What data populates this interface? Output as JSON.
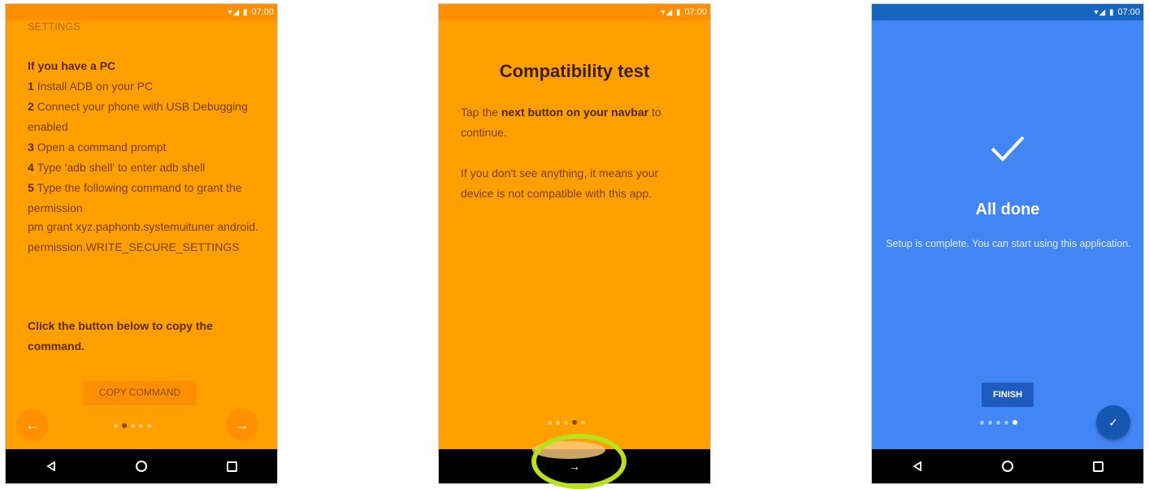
{
  "statusbar": {
    "icons": "▾◢ ▮",
    "time": "07:00"
  },
  "nav_icons": {
    "back": "back-icon",
    "home": "home-icon",
    "recent": "recent-apps-icon"
  },
  "screen1": {
    "faded_heading": "SETTINGS",
    "heading": "If you have a PC",
    "steps": [
      {
        "num": "1",
        "text": "Install ADB on your PC"
      },
      {
        "num": "2",
        "text": "Connect your phone with USB Debugging enabled"
      },
      {
        "num": "3",
        "text": "Open a command prompt"
      },
      {
        "num": "4",
        "text": "Type 'adb shell' to enter adb shell"
      },
      {
        "num": "5",
        "text": "Type the following command to grant the permission"
      }
    ],
    "command": "pm grant xyz.paphonb.systemuituner android.permission.WRITE_SECURE_SETTINGS",
    "instruction": "Click the button below to copy the command.",
    "copy_button": "COPY COMMAND",
    "prev_glyph": "←",
    "next_glyph": "→",
    "page_count": 5,
    "active_page": 1
  },
  "screen2": {
    "title": "Compatibility test",
    "para1_pre": "Tap the ",
    "para1_bold": "next button on your navbar",
    "para1_post": " to continue.",
    "para2": "If you don't see anything, it means your device is not compatible with this app.",
    "nav_next_glyph": "→",
    "page_count": 5,
    "active_page": 3
  },
  "screen3": {
    "title": "All done",
    "message": "Setup is complete. You can start using this application.",
    "finish_button": "FINISH",
    "fab_glyph": "✓",
    "page_count": 5,
    "active_page": 4
  },
  "colors": {
    "orange": "#ffa000",
    "orange_dark": "#ff8f00",
    "blue": "#4285f4",
    "blue_dark": "#1565c0",
    "highlight": "#b8e01c"
  }
}
